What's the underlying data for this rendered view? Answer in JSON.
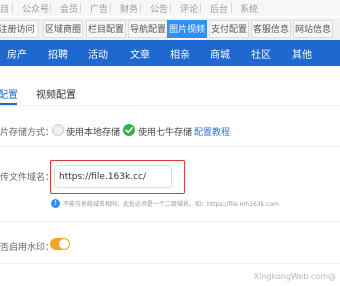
{
  "top_nav": {
    "items": [
      "目",
      "公众号",
      "会员",
      "广告",
      "财务",
      "公告",
      "评论",
      "后台",
      "系统"
    ]
  },
  "module_tabs": {
    "items": [
      "注册访问",
      "区域商圈",
      "栏目配置",
      "导航配置",
      "图片视频",
      "支付配置",
      "客服信息",
      "网站信息"
    ],
    "active_index": 4
  },
  "main_nav": {
    "items": [
      "房产",
      "招聘",
      "活动",
      "文章",
      "相亲",
      "商城",
      "社区",
      "其他"
    ]
  },
  "sub_tabs": {
    "items": [
      "配置",
      "视频配置"
    ],
    "active_index": 0
  },
  "storage": {
    "label": "片存储方式：",
    "options": [
      {
        "label": "使用本地存储",
        "selected": false
      },
      {
        "label": "使用七牛存储",
        "selected": true
      }
    ],
    "tutorial_link": "配置教程"
  },
  "domain_field": {
    "label": "传文件域名：",
    "value": "https://file.163k.cc/",
    "hint": "不能与系统域名相同，此处必须是一个二级域名。如：https://file.mh163k.com",
    "hint_icon": "info-icon"
  },
  "watermark_setting": {
    "label": "否启用水印：",
    "enabled": true
  },
  "colors": {
    "primary": "#1f68cf",
    "tab_active": "#2f8ff4",
    "highlight_border": "#e03a3a",
    "toggle_on": "#f5a623",
    "radio_on": "#33b04a"
  },
  "site_watermark": "XingkongWeb.com@"
}
